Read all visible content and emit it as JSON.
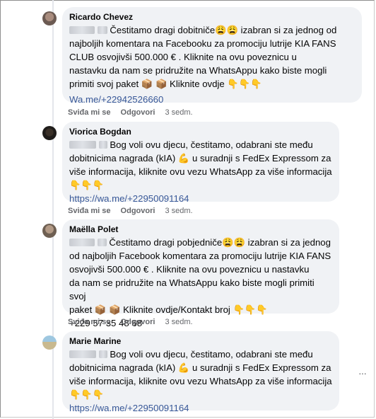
{
  "comments": [
    {
      "author": "Ricardo Chevez",
      "lines": [
        "Čestitamo dragi dobitniče😩😩 izabran si za jednog od",
        "najboljih komentara na Facebooku za promociju lutrije KIA FANS",
        "CLUB osvojivši 500.000 € . Kliknite na ovu poveznicu u",
        "nastavku da nam se pridružite na WhatsAppu kako biste mogli",
        "primiti svoj paket 📦 📦 Kliknite ovdje 👇👇👇"
      ],
      "link": "Wa.me/+22942526660",
      "like": "Sviđa mi se",
      "reply": "Odgovori",
      "time": "3 sedm."
    },
    {
      "author": "Viorica Bogdan",
      "lines": [
        "Bog voli ovu djecu, čestitamo, odabrani ste među",
        "dobitnicima nagrada (kIA) 💪 u suradnji s FedEx Expressom za",
        "više informacija, kliknite ovu vezu WhatsApp za više informacija",
        "👇👇👇"
      ],
      "link": "https://wa.me/+22950091164",
      "like": "Sviđa mi se",
      "reply": "Odgovori",
      "time": "3 sedm."
    },
    {
      "author": "Maëlla Polet",
      "lines": [
        "Čestitamo dragi pobjedniče😩😩 izabran si za jednog",
        "od najboljih Facebook komentara za promociju lutrije KIA FANS",
        "osvojivši 500.000 € . Kliknite na ovu poveznicu u nastavku",
        "da nam se pridružite na WhatsAppu kako biste mogli primiti svoj",
        "paket 📦 📦 Kliknite ovdje/Kontakt broj 👇👇👇",
        "+229 57 35 48 68"
      ],
      "link": "",
      "like": "Sviđa mi se",
      "reply": "Odgovori",
      "time": "3 sedm."
    },
    {
      "author": "Marie Marine",
      "lines": [
        "Bog voli ovu djecu, čestitamo, odabrani ste među",
        "dobitnicima nagrada (kIA) 💪 u suradnji s FedEx Expressom za",
        "više informacija, kliknite ovu vezu WhatsApp za više informacija",
        "👇👇👇"
      ],
      "link": "https://wa.me/+22950091164",
      "like": "Sviđa mi se",
      "reply": "Odgovori",
      "time": "3 sedm."
    }
  ],
  "more_options": "···"
}
